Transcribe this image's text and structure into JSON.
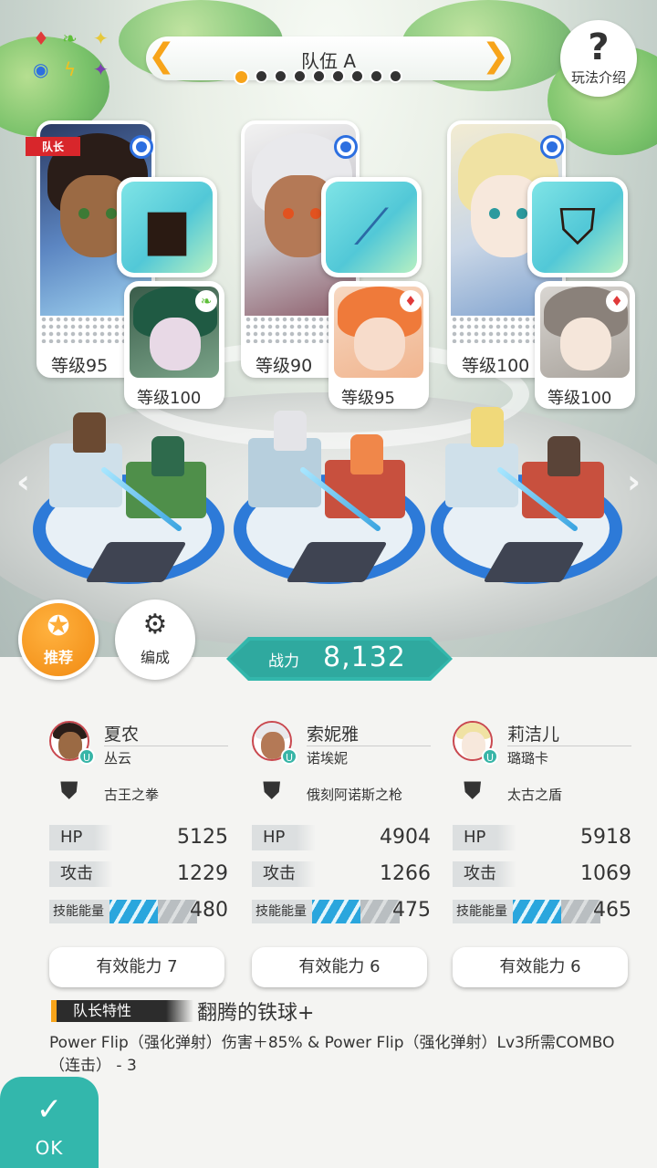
{
  "header": {
    "team_name": "队伍 A",
    "help_label": "玩法介绍",
    "team_page_count": 9,
    "team_page_index": 1
  },
  "elements_icons": [
    "fire-diamond-icon",
    "wind-leaf-icon",
    "light-sparkle-icon",
    "water-orb-icon",
    "thunder-bolt-icon",
    "dark-star-icon"
  ],
  "leader_tag": "队长",
  "cards": [
    {
      "main_level": "等级95",
      "sub_level": "等级100",
      "sub_attribute": "wind",
      "equipment_icon": "gauntlet-icon"
    },
    {
      "main_level": "等级90",
      "sub_level": "等级95",
      "sub_attribute": "fire",
      "equipment_icon": "lance-icon"
    },
    {
      "main_level": "等级100",
      "sub_level": "等级100",
      "sub_attribute": "fire",
      "equipment_icon": "shield-icon"
    }
  ],
  "buttons": {
    "recommend_label": "推荐",
    "formation_label": "编成",
    "ok_label": "OK"
  },
  "power": {
    "label": "战力",
    "value": "8,132"
  },
  "columns": [
    {
      "name": "夏农",
      "sub_name": "丛云",
      "equipment": "古王之拳",
      "hp_label": "HP",
      "hp": "5125",
      "atk_label": "攻击",
      "atk": "1229",
      "energy_label": "技能能量",
      "energy": "480",
      "energy_fill": 0.55,
      "ability": "有效能力 7"
    },
    {
      "name": "索妮雅",
      "sub_name": "诺埃妮",
      "equipment": "俄刻阿诺斯之枪",
      "hp_label": "HP",
      "hp": "4904",
      "atk_label": "攻击",
      "atk": "1266",
      "energy_label": "技能能量",
      "energy": "475",
      "energy_fill": 0.55,
      "ability": "有效能力 6"
    },
    {
      "name": "莉洁儿",
      "sub_name": "璐璐卡",
      "equipment": "太古之盾",
      "hp_label": "HP",
      "hp": "5918",
      "atk_label": "攻击",
      "atk": "1069",
      "energy_label": "技能能量",
      "energy": "465",
      "energy_fill": 0.55,
      "ability": "有效能力 6"
    }
  ],
  "leader_trait": {
    "tag": "队长特性",
    "name": "翻腾的铁球+",
    "description": "Power Flip（强化弹射）伤害＋85% & Power Flip（强化弹射）Lv3所需COMBO（连击） - 3"
  },
  "colors": {
    "accent_orange": "#f7a41a",
    "teal": "#33b7ac",
    "leader_red": "#d8262b",
    "water_blue": "#2d6fe0"
  }
}
